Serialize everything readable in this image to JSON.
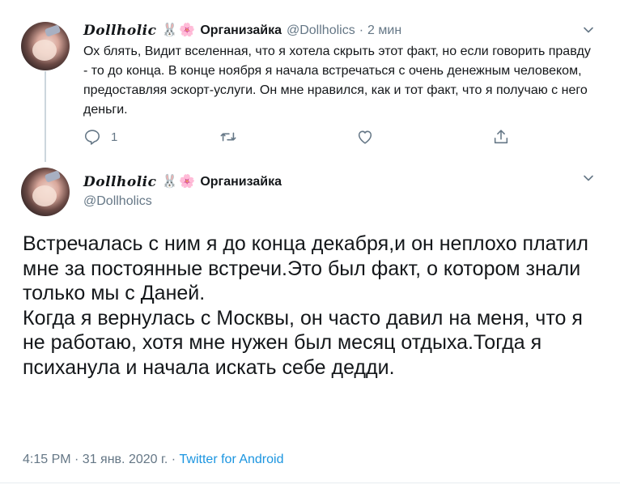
{
  "tweet1": {
    "display_name": "Dollholic",
    "name_suffix": "Организайка",
    "handle": "@Dollholics",
    "separator": "·",
    "time": "2 мин",
    "text": "Ох блять, Видит вселенная, что я хотела скрыть этот факт, но если говорить правду - то до конца.  В конце ноября я начала встречаться с очень денежным человеком, предоставляя эскорт-услуги. Он мне нравился, как и тот факт, что я получаю с него деньги.",
    "reply_count": "1"
  },
  "tweet2": {
    "display_name": "Dollholic",
    "name_suffix": "Организайка",
    "handle": "@Dollholics",
    "paragraph1": "Встречалась с ним я до конца декабря,и он неплохо платил мне за постоянные встречи.Это был факт, о котором знали только мы с Даней.",
    "paragraph2": "Когда я вернулась с Москвы, он часто давил на меня, что я не работаю, хотя мне нужен был месяц отдыха.Тогда я психанула и начала искать себе дедди.",
    "timestamp": "4:15 PM · 31 янв. 2020 г. · ",
    "source": "Twitter for Android"
  },
  "icons": {
    "bunny": "🐰",
    "flower": "🌸"
  },
  "colors": {
    "text": "#14171a",
    "muted": "#657786",
    "link": "#1b95e0",
    "line": "#ccd6dd"
  }
}
